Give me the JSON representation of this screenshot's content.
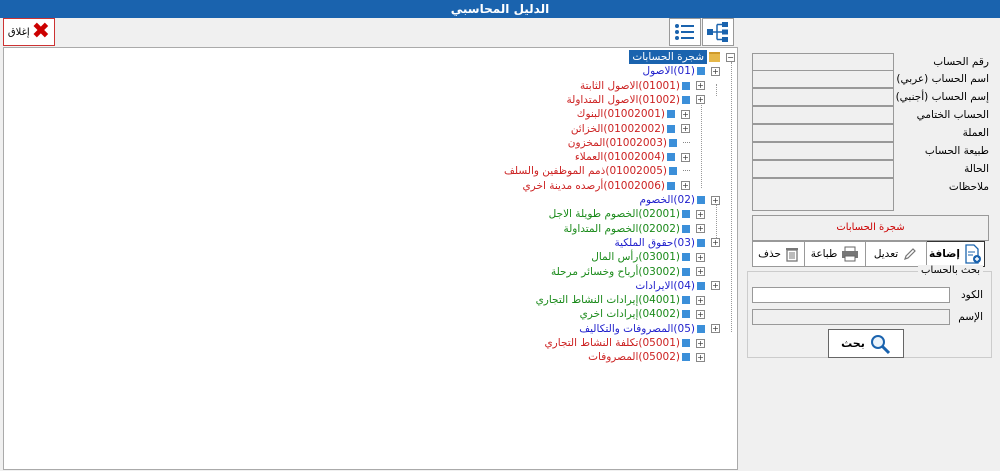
{
  "window": {
    "title": "الدليل المحاسبي"
  },
  "toolbar": {
    "close_label": "إغلاق"
  },
  "colors": {
    "titlebar": "#1a63ae",
    "level1": "#0000cc",
    "level2_red": "#cc0000",
    "level2_green": "#1a8a1a"
  },
  "tree": {
    "root_label": "شجرة الحسابات",
    "nodes": [
      {
        "label": "(01)الاصول",
        "color": "#1f1fcc"
      },
      {
        "label": "(01001)الاصول الثابتة",
        "color": "#cc2222"
      },
      {
        "label": "(01002)الاصول المتداولة",
        "color": "#cc2222"
      },
      {
        "label": "(01002001)البنوك",
        "color": "#cc2222"
      },
      {
        "label": "(01002002)الخزائن",
        "color": "#cc2222"
      },
      {
        "label": "(01002003)المخزون",
        "color": "#cc2222"
      },
      {
        "label": "(01002004)العملاء",
        "color": "#cc2222"
      },
      {
        "label": "(01002005)ذمم الموظفين والسلف",
        "color": "#cc2222"
      },
      {
        "label": "(01002006)أرصده مدينة اخري",
        "color": "#cc2222"
      },
      {
        "label": "(02)الخصوم",
        "color": "#1f1fcc"
      },
      {
        "label": "(02001)الخصوم طويلة الاجل",
        "color": "#1a8a1a"
      },
      {
        "label": "(02002)الخصوم المتداولة",
        "color": "#1a8a1a"
      },
      {
        "label": "(03)حقوق الملكية",
        "color": "#1f1fcc"
      },
      {
        "label": "(03001)رأس المال",
        "color": "#1a8a1a"
      },
      {
        "label": "(03002)أرباح وخسائر مرحلة",
        "color": "#1a8a1a"
      },
      {
        "label": "(04)الايرادات",
        "color": "#1f1fcc"
      },
      {
        "label": "(04001)إيرادات النشاط التجاري",
        "color": "#1a8a1a"
      },
      {
        "label": "(04002)إيرادات اخري",
        "color": "#1a8a1a"
      },
      {
        "label": "(05)المصروفات والتكاليف",
        "color": "#1f1fcc"
      },
      {
        "label": "(05001)تكلفة النشاط التجاري",
        "color": "#cc2222"
      },
      {
        "label": "(05002)المصروفات",
        "color": "#cc2222"
      }
    ]
  },
  "details": {
    "account_number_label": "رقم الحساب",
    "account_name_ar_label": "اسم الحساب (عربي)",
    "account_name_foreign_label": "إسم الحساب (أجنبي)",
    "final_account_label": "الحساب الختامي",
    "currency_label": "العملة",
    "account_nature_label": "طبيعة الحساب",
    "status_label": "الحالة",
    "notes_label": "ملاحظات",
    "account_tree_button": "شجرة الحسابات"
  },
  "actions": {
    "add": "إضافة",
    "edit": "تعديل",
    "print": "طباعة",
    "delete": "حذف"
  },
  "search": {
    "legend": "بحث بالحساب",
    "code_label": "الكود",
    "name_label": "الإسم",
    "code_value": "",
    "name_value": "",
    "button": "بحث"
  }
}
